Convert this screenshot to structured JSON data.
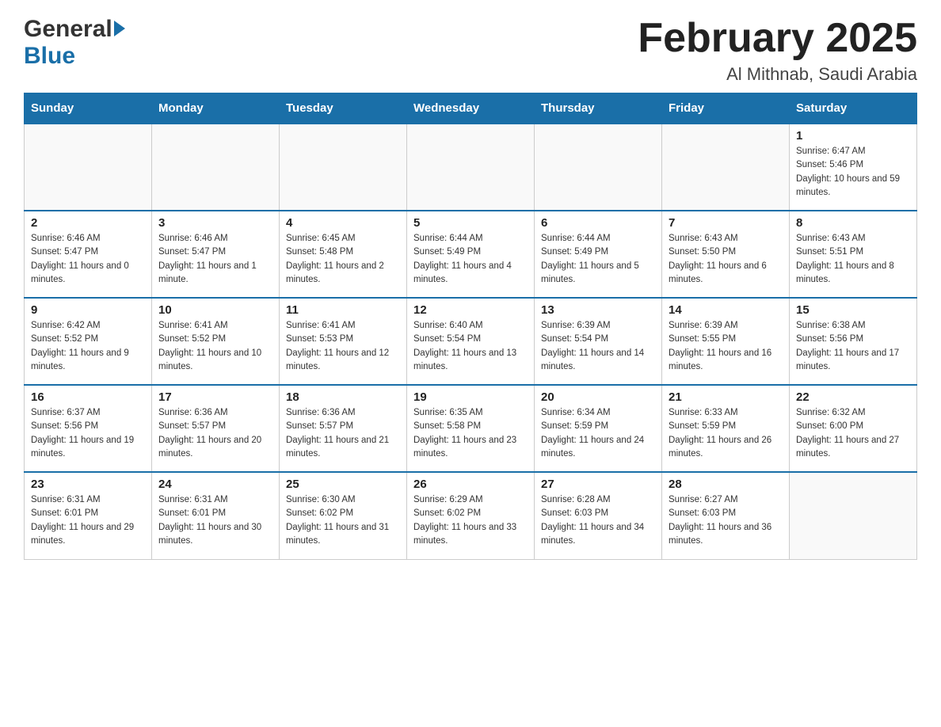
{
  "header": {
    "logo_general": "General",
    "logo_blue": "Blue",
    "month_title": "February 2025",
    "location": "Al Mithnab, Saudi Arabia"
  },
  "weekdays": [
    "Sunday",
    "Monday",
    "Tuesday",
    "Wednesday",
    "Thursday",
    "Friday",
    "Saturday"
  ],
  "weeks": [
    [
      {
        "day": "",
        "sunrise": "",
        "sunset": "",
        "daylight": ""
      },
      {
        "day": "",
        "sunrise": "",
        "sunset": "",
        "daylight": ""
      },
      {
        "day": "",
        "sunrise": "",
        "sunset": "",
        "daylight": ""
      },
      {
        "day": "",
        "sunrise": "",
        "sunset": "",
        "daylight": ""
      },
      {
        "day": "",
        "sunrise": "",
        "sunset": "",
        "daylight": ""
      },
      {
        "day": "",
        "sunrise": "",
        "sunset": "",
        "daylight": ""
      },
      {
        "day": "1",
        "sunrise": "Sunrise: 6:47 AM",
        "sunset": "Sunset: 5:46 PM",
        "daylight": "Daylight: 10 hours and 59 minutes."
      }
    ],
    [
      {
        "day": "2",
        "sunrise": "Sunrise: 6:46 AM",
        "sunset": "Sunset: 5:47 PM",
        "daylight": "Daylight: 11 hours and 0 minutes."
      },
      {
        "day": "3",
        "sunrise": "Sunrise: 6:46 AM",
        "sunset": "Sunset: 5:47 PM",
        "daylight": "Daylight: 11 hours and 1 minute."
      },
      {
        "day": "4",
        "sunrise": "Sunrise: 6:45 AM",
        "sunset": "Sunset: 5:48 PM",
        "daylight": "Daylight: 11 hours and 2 minutes."
      },
      {
        "day": "5",
        "sunrise": "Sunrise: 6:44 AM",
        "sunset": "Sunset: 5:49 PM",
        "daylight": "Daylight: 11 hours and 4 minutes."
      },
      {
        "day": "6",
        "sunrise": "Sunrise: 6:44 AM",
        "sunset": "Sunset: 5:49 PM",
        "daylight": "Daylight: 11 hours and 5 minutes."
      },
      {
        "day": "7",
        "sunrise": "Sunrise: 6:43 AM",
        "sunset": "Sunset: 5:50 PM",
        "daylight": "Daylight: 11 hours and 6 minutes."
      },
      {
        "day": "8",
        "sunrise": "Sunrise: 6:43 AM",
        "sunset": "Sunset: 5:51 PM",
        "daylight": "Daylight: 11 hours and 8 minutes."
      }
    ],
    [
      {
        "day": "9",
        "sunrise": "Sunrise: 6:42 AM",
        "sunset": "Sunset: 5:52 PM",
        "daylight": "Daylight: 11 hours and 9 minutes."
      },
      {
        "day": "10",
        "sunrise": "Sunrise: 6:41 AM",
        "sunset": "Sunset: 5:52 PM",
        "daylight": "Daylight: 11 hours and 10 minutes."
      },
      {
        "day": "11",
        "sunrise": "Sunrise: 6:41 AM",
        "sunset": "Sunset: 5:53 PM",
        "daylight": "Daylight: 11 hours and 12 minutes."
      },
      {
        "day": "12",
        "sunrise": "Sunrise: 6:40 AM",
        "sunset": "Sunset: 5:54 PM",
        "daylight": "Daylight: 11 hours and 13 minutes."
      },
      {
        "day": "13",
        "sunrise": "Sunrise: 6:39 AM",
        "sunset": "Sunset: 5:54 PM",
        "daylight": "Daylight: 11 hours and 14 minutes."
      },
      {
        "day": "14",
        "sunrise": "Sunrise: 6:39 AM",
        "sunset": "Sunset: 5:55 PM",
        "daylight": "Daylight: 11 hours and 16 minutes."
      },
      {
        "day": "15",
        "sunrise": "Sunrise: 6:38 AM",
        "sunset": "Sunset: 5:56 PM",
        "daylight": "Daylight: 11 hours and 17 minutes."
      }
    ],
    [
      {
        "day": "16",
        "sunrise": "Sunrise: 6:37 AM",
        "sunset": "Sunset: 5:56 PM",
        "daylight": "Daylight: 11 hours and 19 minutes."
      },
      {
        "day": "17",
        "sunrise": "Sunrise: 6:36 AM",
        "sunset": "Sunset: 5:57 PM",
        "daylight": "Daylight: 11 hours and 20 minutes."
      },
      {
        "day": "18",
        "sunrise": "Sunrise: 6:36 AM",
        "sunset": "Sunset: 5:57 PM",
        "daylight": "Daylight: 11 hours and 21 minutes."
      },
      {
        "day": "19",
        "sunrise": "Sunrise: 6:35 AM",
        "sunset": "Sunset: 5:58 PM",
        "daylight": "Daylight: 11 hours and 23 minutes."
      },
      {
        "day": "20",
        "sunrise": "Sunrise: 6:34 AM",
        "sunset": "Sunset: 5:59 PM",
        "daylight": "Daylight: 11 hours and 24 minutes."
      },
      {
        "day": "21",
        "sunrise": "Sunrise: 6:33 AM",
        "sunset": "Sunset: 5:59 PM",
        "daylight": "Daylight: 11 hours and 26 minutes."
      },
      {
        "day": "22",
        "sunrise": "Sunrise: 6:32 AM",
        "sunset": "Sunset: 6:00 PM",
        "daylight": "Daylight: 11 hours and 27 minutes."
      }
    ],
    [
      {
        "day": "23",
        "sunrise": "Sunrise: 6:31 AM",
        "sunset": "Sunset: 6:01 PM",
        "daylight": "Daylight: 11 hours and 29 minutes."
      },
      {
        "day": "24",
        "sunrise": "Sunrise: 6:31 AM",
        "sunset": "Sunset: 6:01 PM",
        "daylight": "Daylight: 11 hours and 30 minutes."
      },
      {
        "day": "25",
        "sunrise": "Sunrise: 6:30 AM",
        "sunset": "Sunset: 6:02 PM",
        "daylight": "Daylight: 11 hours and 31 minutes."
      },
      {
        "day": "26",
        "sunrise": "Sunrise: 6:29 AM",
        "sunset": "Sunset: 6:02 PM",
        "daylight": "Daylight: 11 hours and 33 minutes."
      },
      {
        "day": "27",
        "sunrise": "Sunrise: 6:28 AM",
        "sunset": "Sunset: 6:03 PM",
        "daylight": "Daylight: 11 hours and 34 minutes."
      },
      {
        "day": "28",
        "sunrise": "Sunrise: 6:27 AM",
        "sunset": "Sunset: 6:03 PM",
        "daylight": "Daylight: 11 hours and 36 minutes."
      },
      {
        "day": "",
        "sunrise": "",
        "sunset": "",
        "daylight": ""
      }
    ]
  ]
}
